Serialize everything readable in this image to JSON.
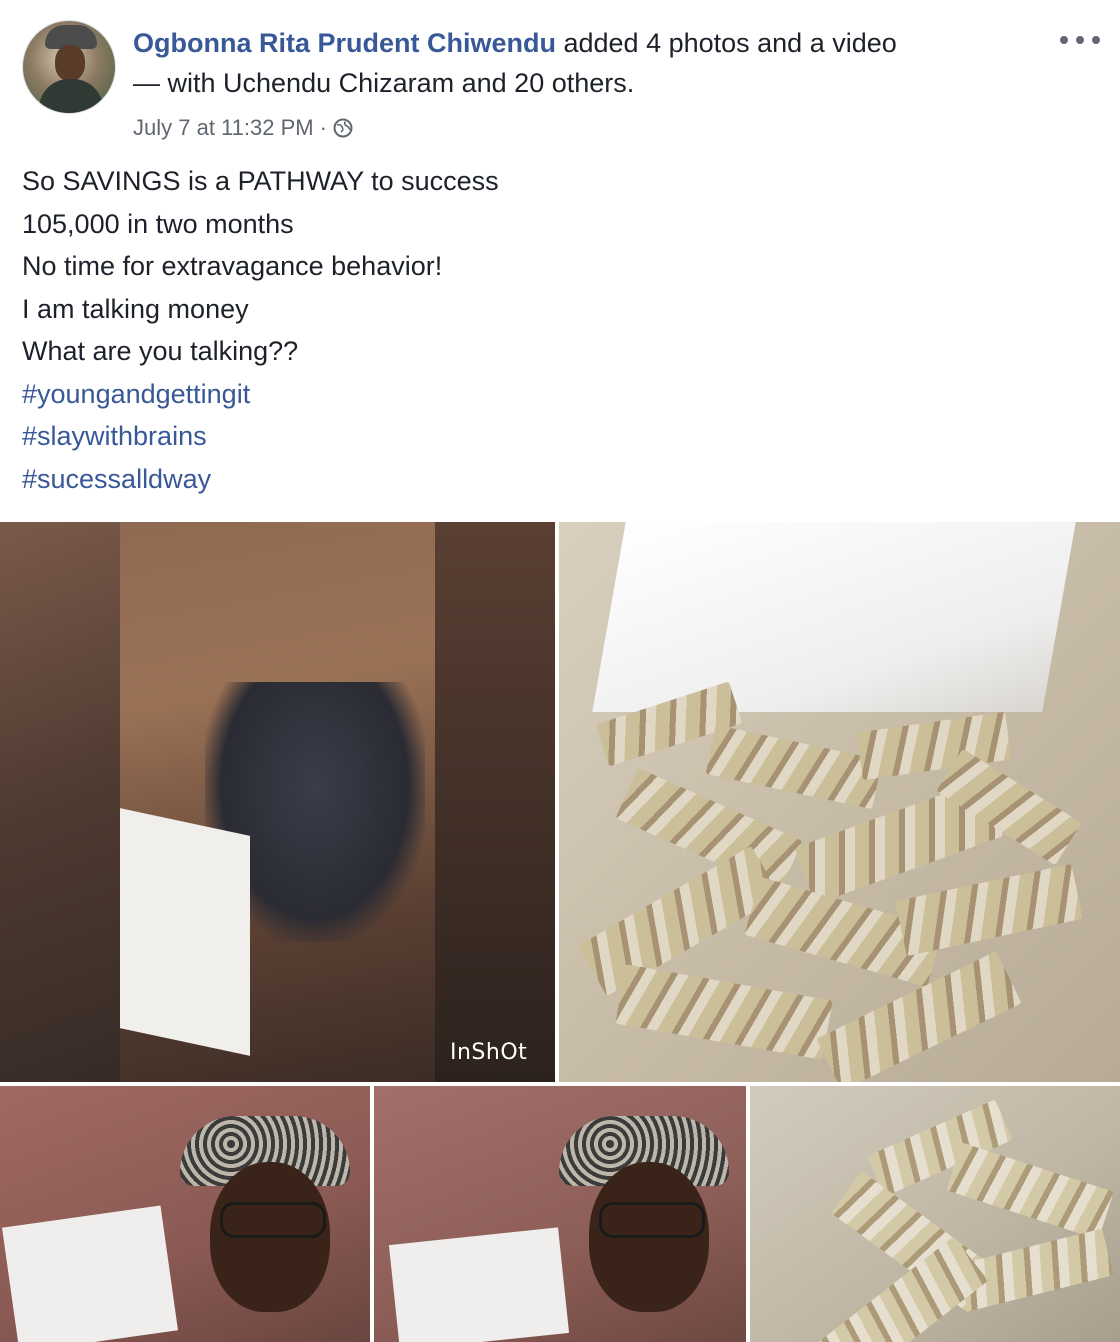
{
  "post": {
    "author": "Ogbonna Rita Prudent Chiwendu",
    "action": " added 4 photos and a video",
    "tagged": "— with Uchendu Chizaram and 20 others.",
    "timestamp": "July 7 at 11:32 PM",
    "separator": "·",
    "privacy_icon": "globe-icon",
    "more_icon": "more-options-icon",
    "lines": [
      "So SAVINGS is a PATHWAY to success",
      "105,000 in two months",
      "No time for extravagance behavior!",
      "I am talking money",
      "What are you talking??"
    ],
    "hashtags": [
      "#youngandgettingit",
      "#slaywithbrains",
      "#sucessalldway"
    ]
  },
  "media": {
    "video_watermark": "InShOt"
  },
  "colors": {
    "link": "#385898",
    "text": "#1d2129",
    "meta": "#606770"
  }
}
